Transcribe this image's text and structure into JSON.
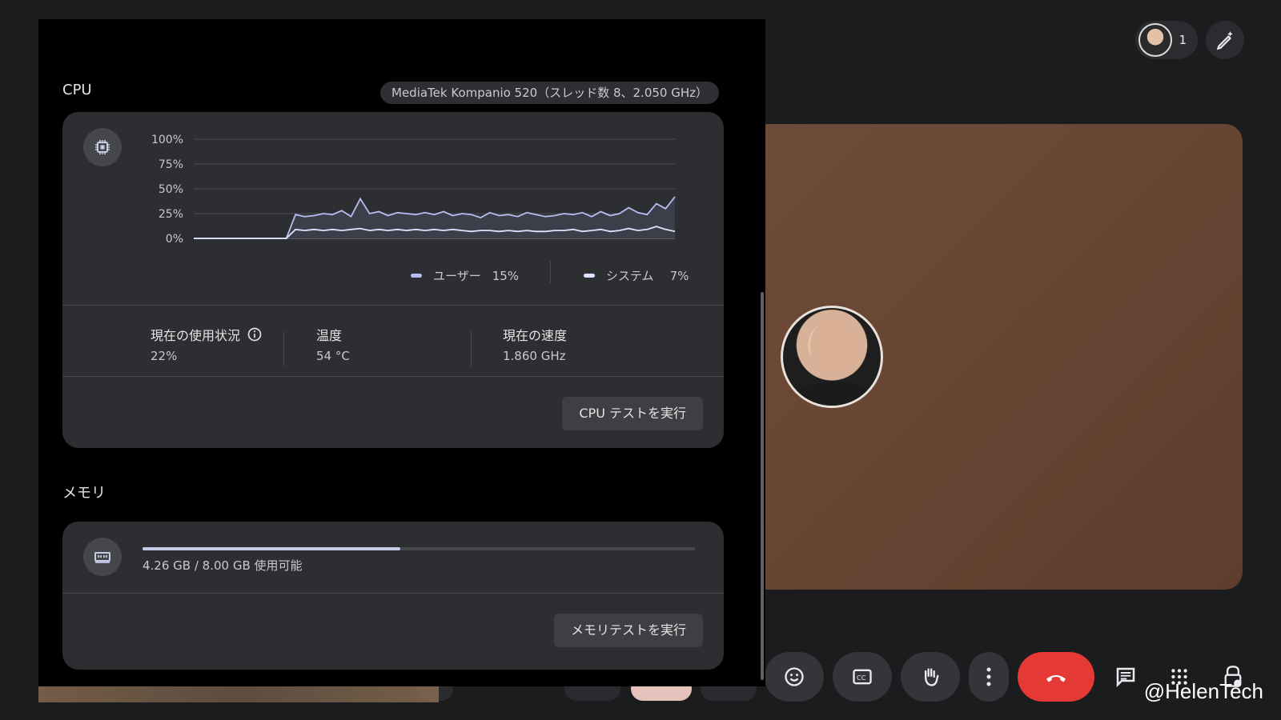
{
  "top_right": {
    "participant_count": "1"
  },
  "watermark": "@HelenTech",
  "cpu": {
    "section_title": "CPU",
    "chip_label": "MediaTek Kompanio 520（スレッド数 8、2.050 GHz）",
    "chart_data": {
      "type": "area",
      "title": "",
      "xlabel": "",
      "ylabel": "",
      "ylim": [
        0,
        100
      ],
      "yticks": [
        "100%",
        "75%",
        "50%",
        "25%",
        "0%"
      ],
      "x": [
        0,
        1,
        2,
        3,
        4,
        5,
        6,
        7,
        8,
        9,
        10,
        11,
        12,
        13,
        14,
        15,
        16,
        17,
        18,
        19,
        20,
        21,
        22,
        23,
        24,
        25,
        26,
        27,
        28,
        29,
        30,
        31,
        32,
        33,
        34,
        35,
        36,
        37,
        38,
        39,
        40,
        41,
        42,
        43,
        44,
        45,
        46,
        47,
        48,
        49,
        50,
        51,
        52
      ],
      "series": [
        {
          "name": "ユーザー",
          "values": [
            0,
            0,
            0,
            0,
            0,
            0,
            0,
            0,
            0,
            0,
            0,
            24,
            22,
            23,
            25,
            24,
            28,
            22,
            40,
            25,
            27,
            23,
            26,
            25,
            24,
            26,
            24,
            27,
            23,
            25,
            24,
            21,
            26,
            23,
            24,
            22,
            26,
            24,
            22,
            23,
            25,
            24,
            26,
            22,
            27,
            23,
            25,
            31,
            26,
            24,
            35,
            30,
            42
          ]
        },
        {
          "name": "システム",
          "values": [
            0,
            0,
            0,
            0,
            0,
            0,
            0,
            0,
            0,
            0,
            0,
            9,
            8,
            9,
            8,
            9,
            8,
            9,
            10,
            8,
            9,
            8,
            9,
            8,
            9,
            8,
            9,
            8,
            9,
            8,
            7,
            8,
            8,
            7,
            8,
            7,
            8,
            7,
            7,
            8,
            8,
            9,
            7,
            8,
            9,
            7,
            8,
            10,
            8,
            9,
            12,
            9,
            7
          ]
        }
      ],
      "legend_values": {
        "user": "15%",
        "system": "7%"
      },
      "colors": {
        "user": "#b7bdf0",
        "system": "#dfe2ff"
      }
    },
    "legend": {
      "user_label": "ユーザー",
      "user_value": "15%",
      "system_label": "システム",
      "system_value": "7%"
    },
    "stats": {
      "usage_label": "現在の使用状況",
      "usage_value": "22%",
      "temp_label": "温度",
      "temp_value": "54 °C",
      "speed_label": "現在の速度",
      "speed_value": "1.860 GHz"
    },
    "run_test_label": "CPU テストを実行"
  },
  "memory": {
    "section_title": "メモリ",
    "usage_text": "4.26 GB / 8.00 GB 使用可能",
    "used_fraction": 0.467,
    "run_test_label": "メモリテストを実行"
  }
}
